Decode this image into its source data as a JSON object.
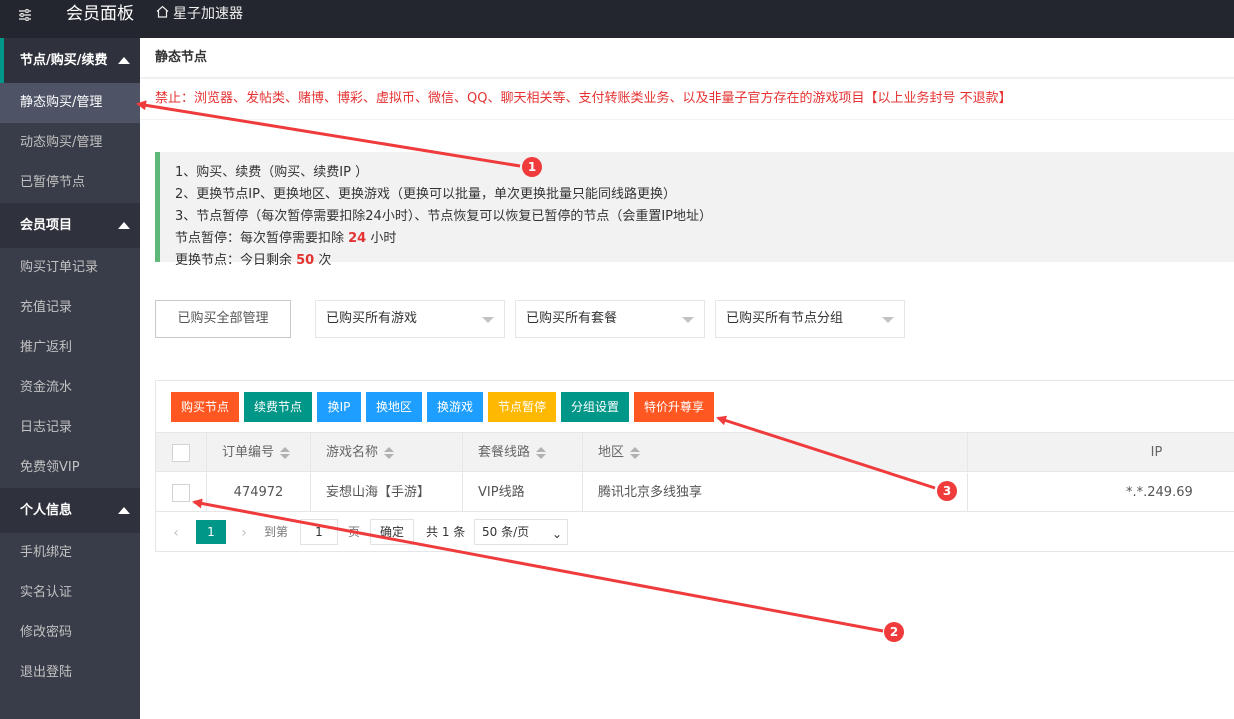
{
  "topbar": {
    "menu_icon": "sliders-icon",
    "brand": "会员面板",
    "home_icon": "home-icon",
    "home_label": "星子加速器"
  },
  "sidebar": {
    "groups": [
      {
        "label": "节点/购买/续费",
        "items": [
          "静态购买/管理",
          "动态购买/管理",
          "已暂停节点"
        ]
      },
      {
        "label": "会员项目",
        "items": [
          "购买订单记录",
          "充值记录",
          "推广返利",
          "资金流水",
          "日志记录",
          "免费领VIP"
        ]
      },
      {
        "label": "个人信息",
        "items": [
          "手机绑定",
          "实名认证",
          "修改密码",
          "退出登陆"
        ]
      }
    ]
  },
  "page": {
    "title": "静态节点",
    "warning": "禁止：浏览器、发帖类、赌博、博彩、虚拟币、微信、QQ、聊天相关等、支付转账类业务、以及非量子官方存在的游戏项目【以上业务封号 不退款】"
  },
  "notice": {
    "line1": "1、购买、续费（购买、续费IP ）",
    "line2": "2、更换节点IP、更换地区、更换游戏（更换可以批量，单次更换批量只能同线路更换）",
    "line3": "3、节点暂停（每次暂停需要扣除24小时）、节点恢复可以恢复已暂停的节点（会重置IP地址）",
    "pause_prefix": "节点暂停：每次暂停需要扣除 ",
    "pause_value": "24",
    "pause_suffix": " 小时",
    "change_prefix": "更换节点：今日剩余 ",
    "change_value": "50",
    "change_suffix": " 次"
  },
  "filters": {
    "manage_all": "已购买全部管理",
    "select_game": "已购买所有游戏",
    "select_plan": "已购买所有套餐",
    "select_group": "已购买所有节点分组"
  },
  "toolbar": [
    {
      "label": "购买节点",
      "color": "#ff5722"
    },
    {
      "label": "续费节点",
      "color": "#009688"
    },
    {
      "label": "换IP",
      "color": "#1e9fff"
    },
    {
      "label": "换地区",
      "color": "#1e9fff"
    },
    {
      "label": "换游戏",
      "color": "#1e9fff"
    },
    {
      "label": "节点暂停",
      "color": "#ffb800"
    },
    {
      "label": "分组设置",
      "color": "#009688"
    },
    {
      "label": "特价升尊享",
      "color": "#ff5722"
    }
  ],
  "table": {
    "headers": {
      "order": "订单编号",
      "game": "游戏名称",
      "line": "套餐线路",
      "region": "地区",
      "ip": "IP"
    },
    "rows": [
      {
        "order": "474972",
        "game": "妄想山海【手游】",
        "line": "VIP线路",
        "region": "腾讯北京多线独享",
        "ip": "*.*.249.69"
      }
    ]
  },
  "pager": {
    "current_page": "1",
    "goto_label": "到第",
    "page_input": "1",
    "page_unit": "页",
    "confirm": "确定",
    "total": "共 1 条",
    "page_size": "50 条/页"
  },
  "annotations": {
    "badge1": "1",
    "badge2": "2",
    "badge3": "3",
    "color": "#ef3b3b"
  }
}
